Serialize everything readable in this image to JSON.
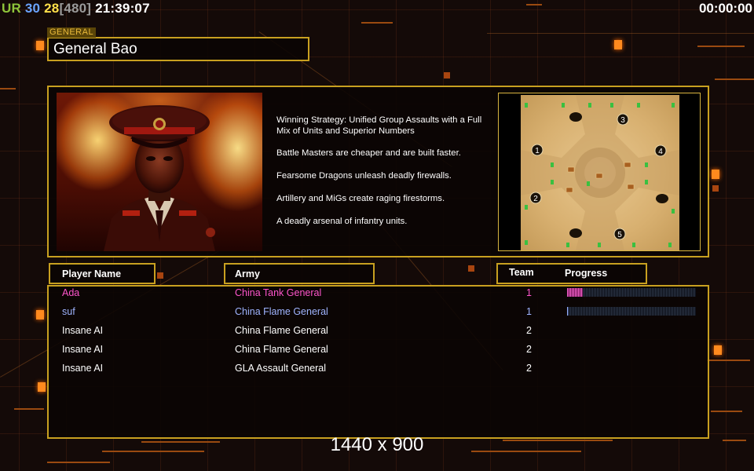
{
  "hud": {
    "ur_label": "UR",
    "num_a": "30",
    "num_b": "28",
    "bracket_value": "[480]",
    "clock": "21:39:07",
    "timer": "00:00:00"
  },
  "general": {
    "tag": "GENERAL",
    "name": "General Bao"
  },
  "strategy": [
    "Winning Strategy: Unified Group Assaults with a Full Mix of Units and Superior Numbers",
    "Battle Masters are cheaper and are built faster.",
    "Fearsome Dragons unleash deadly firewalls.",
    "Artillery and MiGs create raging firestorms.",
    "A deadly arsenal of infantry units."
  ],
  "map": {
    "start_positions": [
      "1",
      "2",
      "3",
      "4",
      "5"
    ]
  },
  "table": {
    "headers": {
      "player": "Player Name",
      "army": "Army",
      "team": "Team",
      "progress": "Progress"
    },
    "rows": [
      {
        "name": "Ada",
        "army": "China Tank General",
        "team": "1",
        "color": "#ff55cc",
        "progress": 0.12
      },
      {
        "name": "suf",
        "army": "China Flame General",
        "team": "1",
        "color": "#9fb4ff",
        "progress": 0.01
      },
      {
        "name": "Insane AI",
        "army": "China Flame General",
        "team": "2",
        "color": "#ffffff"
      },
      {
        "name": "Insane AI",
        "army": "China Flame General",
        "team": "2",
        "color": "#ffffff"
      },
      {
        "name": "Insane AI",
        "army": "GLA Assault General",
        "team": "2",
        "color": "#ffffff"
      }
    ]
  },
  "resolution": "1440 x 900",
  "colors": {
    "frame": "#c8a020",
    "player1": "#ff55cc",
    "player2": "#9fb4ff"
  }
}
